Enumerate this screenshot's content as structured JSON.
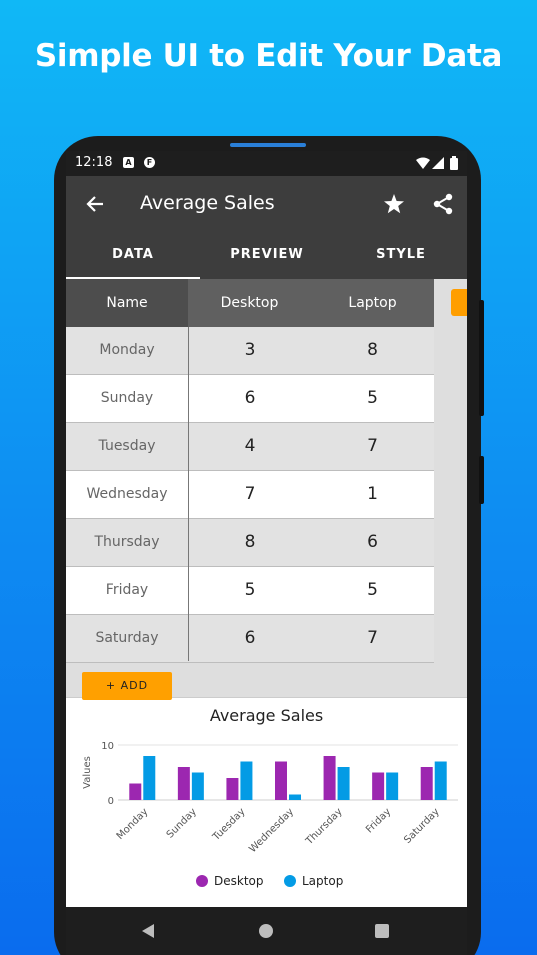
{
  "headline": "Simple UI to Edit Your Data",
  "status": {
    "time": "12:18"
  },
  "appbar": {
    "title": "Average Sales"
  },
  "tabs": [
    {
      "label": "DATA",
      "active": true
    },
    {
      "label": "PREVIEW",
      "active": false
    },
    {
      "label": "STYLE",
      "active": false
    }
  ],
  "table": {
    "headers": [
      "Name",
      "Desktop",
      "Laptop"
    ],
    "rows": [
      {
        "name": "Monday",
        "desktop": "3",
        "laptop": "8"
      },
      {
        "name": "Sunday",
        "desktop": "6",
        "laptop": "5"
      },
      {
        "name": "Tuesday",
        "desktop": "4",
        "laptop": "7"
      },
      {
        "name": "Wednesday",
        "desktop": "7",
        "laptop": "1"
      },
      {
        "name": "Thursday",
        "desktop": "8",
        "laptop": "6"
      },
      {
        "name": "Friday",
        "desktop": "5",
        "laptop": "5"
      },
      {
        "name": "Saturday",
        "desktop": "6",
        "laptop": "7"
      }
    ]
  },
  "add_button": "+ ADD",
  "colors": {
    "desktop": "#9c27b0",
    "laptop": "#039be5",
    "appbar": "#3d3d3d",
    "accent": "#ffa000"
  },
  "chart_data": {
    "type": "bar",
    "title": "Average Sales",
    "ylabel": "Values",
    "xlabel": "",
    "ylim": [
      0,
      10
    ],
    "yticks": [
      "0",
      "10"
    ],
    "categories": [
      "Monday",
      "Sunday",
      "Tuesday",
      "Wednesday",
      "Thursday",
      "Friday",
      "Saturday"
    ],
    "series": [
      {
        "name": "Desktop",
        "values": [
          3,
          6,
          4,
          7,
          8,
          5,
          6
        ]
      },
      {
        "name": "Laptop",
        "values": [
          8,
          5,
          7,
          1,
          6,
          5,
          7
        ]
      }
    ],
    "legend": "bottom"
  }
}
